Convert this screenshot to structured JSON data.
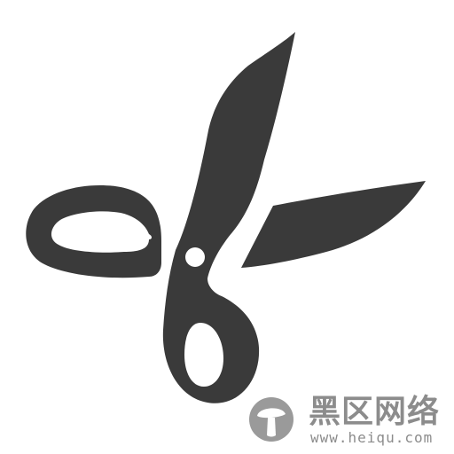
{
  "icon": {
    "name": "scissors-icon",
    "color": "#3a3a3a",
    "background": "#ffffff"
  },
  "watermark": {
    "title": "黑区网络",
    "url": "www.heiqu.com",
    "color": "#8c8c8c"
  }
}
